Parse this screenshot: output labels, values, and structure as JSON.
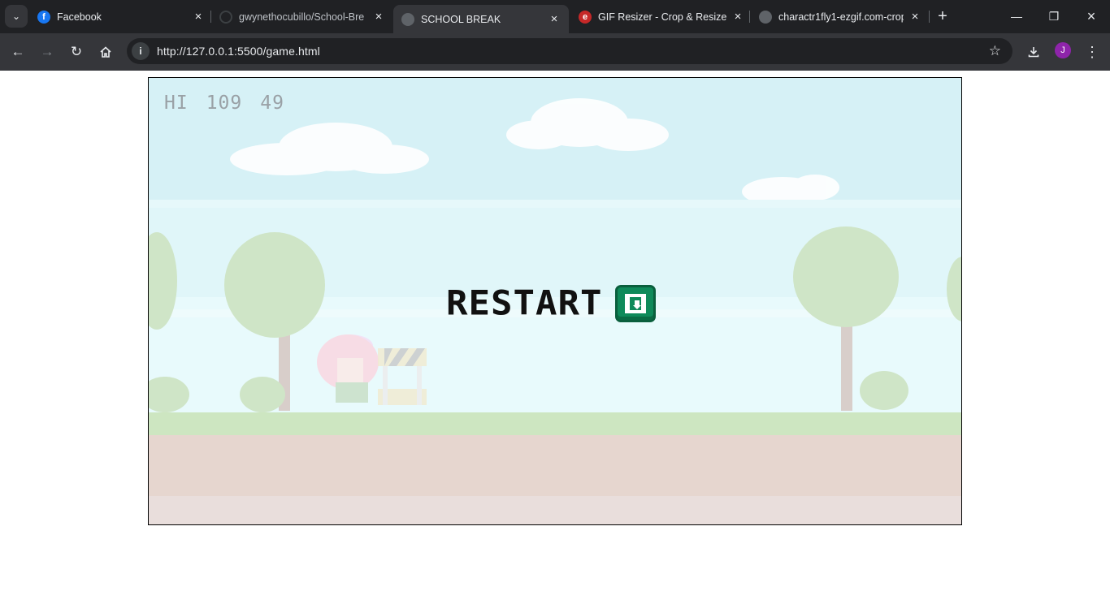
{
  "browser": {
    "tabs": [
      {
        "title": "Facebook",
        "favicon": "facebook-icon",
        "active": false
      },
      {
        "title": "gwynethocubillo/School-Bre",
        "favicon": "github-icon",
        "active": false
      },
      {
        "title": "SCHOOL BREAK",
        "favicon": "globe-icon",
        "active": true
      },
      {
        "title": "GIF Resizer - Crop & Resize",
        "favicon": "ezgif-icon",
        "active": false
      },
      {
        "title": "charactr1fly1-ezgif.com-crop",
        "favicon": "globe-icon",
        "active": false
      }
    ],
    "url": "http://127.0.0.1:5500/game.html",
    "profile_initial": "J",
    "colors": {
      "frame": "#202124",
      "toolbar": "#35363a",
      "omnibox": "#202124",
      "text": "#e8eaed",
      "avatar": "#8e24aa"
    }
  },
  "game": {
    "hud": {
      "hi_label": "HI",
      "hi_score": "109",
      "score": "49"
    },
    "restart_label": "RESTART",
    "colors": {
      "sky": "#bfeaf0",
      "grass": "#9ec98a",
      "dirt": "#c9a99a",
      "restart_button": "#0f8a5a"
    }
  }
}
